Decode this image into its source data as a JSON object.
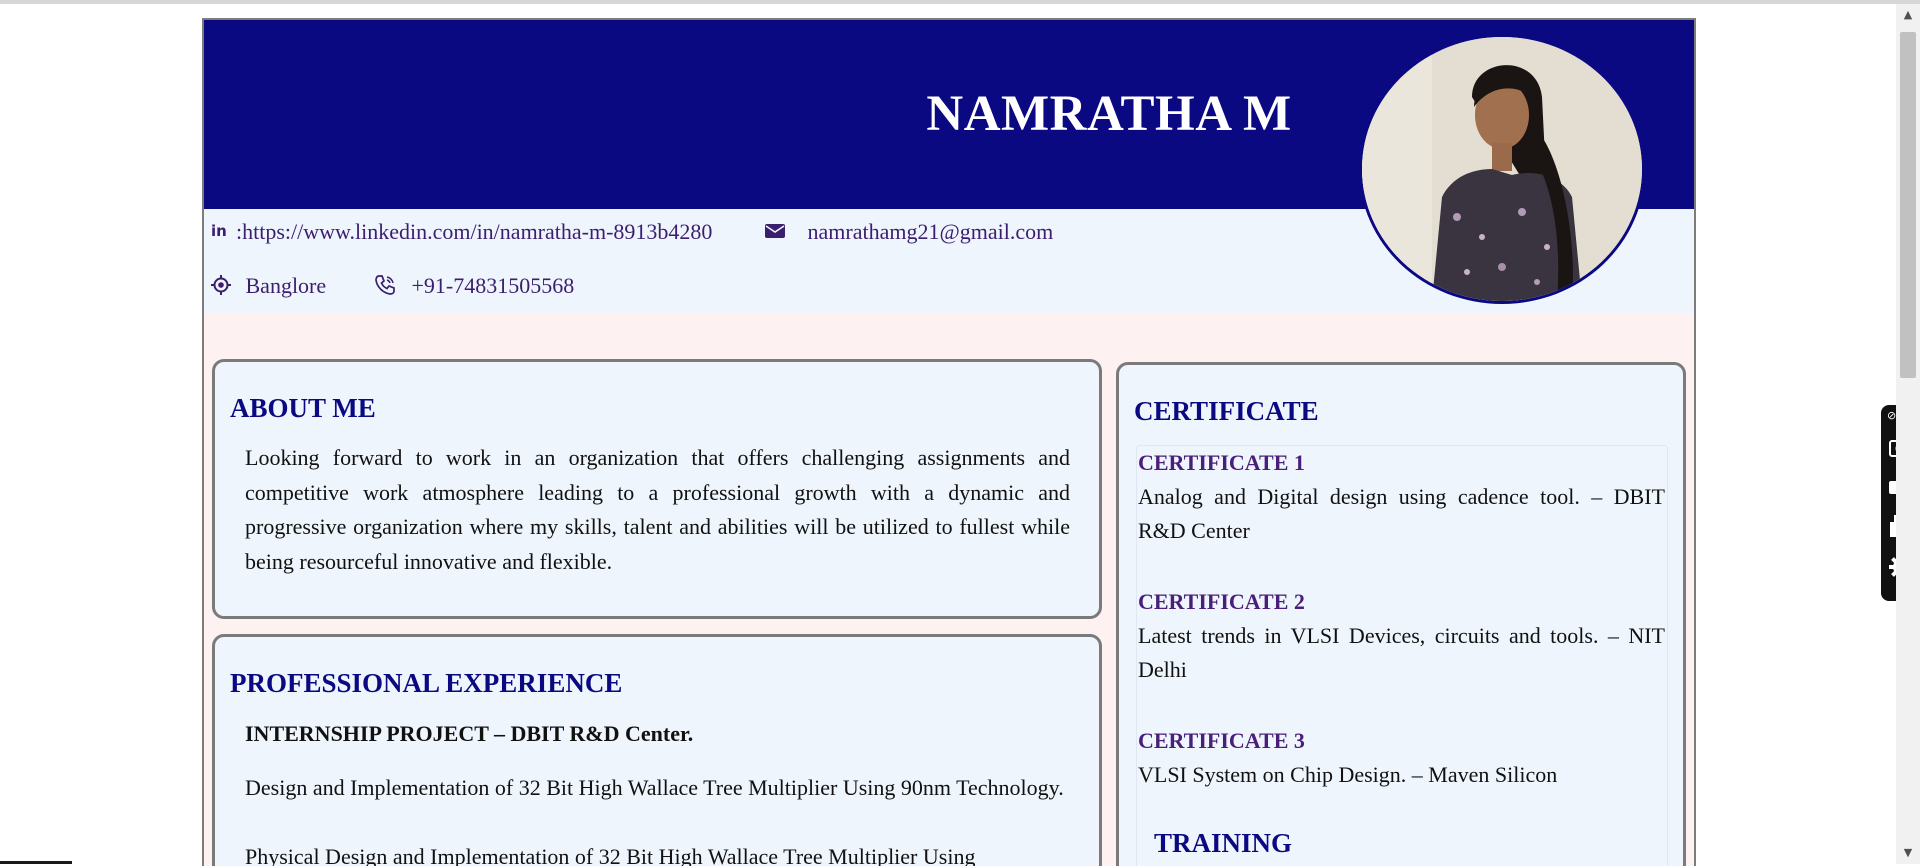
{
  "resume": {
    "name": "NAMRATHA M",
    "contact": {
      "linkedin_prefix": ":",
      "linkedin": "https://www.linkedin.com/in/namratha-m-8913b4280",
      "email": "namrathamg21@gmail.com",
      "location": "Banglore",
      "phone": "+91-74831505568"
    },
    "about": {
      "title": "ABOUT ME",
      "text": "Looking forward to work in an organization that offers challenging assignments and competitive work atmosphere leading to a professional growth with a dynamic and progressive organization where my skills, talent and abilities will be utilized to fullest while being resourceful innovative and flexible."
    },
    "experience": {
      "title": "PROFESSIONAL EXPERIENCE",
      "project_heading": "INTERNSHIP PROJECT – DBIT R&D Center.",
      "line1": "Design and Implementation of 32 Bit High Wallace Tree Multiplier Using 90nm Technology.",
      "line2": "Physical Design and Implementation of 32 Bit High Wallace Tree Multiplier Using"
    },
    "certificates": {
      "title": "CERTIFICATE",
      "items": [
        {
          "title": "CERTIFICATE 1",
          "text": "Analog and Digital design using cadence tool. – DBIT R&D Center"
        },
        {
          "title": "CERTIFICATE 2",
          "text": "Latest trends in VLSI Devices, circuits and tools. – NIT Delhi"
        },
        {
          "title": "CERTIFICATE 3",
          "text": "VLSI System on Chip Design. – Maven Silicon"
        }
      ],
      "training_title": "TRAINING"
    }
  },
  "toolbar": {
    "top_label": "⊘ ···"
  },
  "icons": {
    "linkedin": "linkedin-icon",
    "email": "envelope-icon",
    "location": "location-pin-icon",
    "phone": "phone-icon",
    "camera": "camera-icon",
    "video": "video-camera-icon",
    "windows": "windows-icon",
    "settings": "gear-icon"
  },
  "colors": {
    "header": "#0a0982",
    "contact_text": "#3c1e6e",
    "section_title": "#0a0982",
    "cert_title": "#4a1f7a",
    "page_bg": "#fdf2f1",
    "card_bg": "#eef5fd"
  }
}
